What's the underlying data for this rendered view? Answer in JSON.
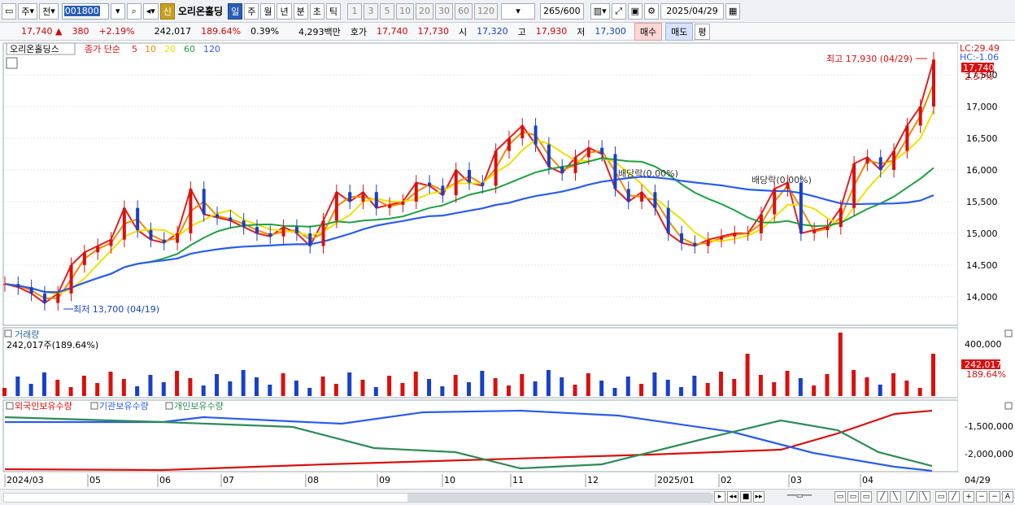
{
  "toolbar": {
    "period": "주",
    "mode": "전",
    "code": "001800",
    "new_badge": "신",
    "stock_name": "오리온홀딩",
    "timeframes": [
      "일",
      "주",
      "월",
      "년",
      "분",
      "초",
      "틱"
    ],
    "active_timeframe": "일",
    "intervals": [
      "1",
      "3",
      "5",
      "10",
      "20",
      "30",
      "60",
      "120"
    ],
    "count": "265",
    "count_total": "/600",
    "date": "2025/04/29"
  },
  "quote": {
    "price": "17,740",
    "up_arrow": "▲",
    "change": "380",
    "change_pct": "+2.19%",
    "volume": "242,017",
    "volume_ratio": "189.64%",
    "turnover": "0.39%",
    "trade_value": "4,293백만",
    "hoga_label": "호가",
    "ask": "17,740",
    "bid": "17,730",
    "open_label": "시",
    "open": "17,320",
    "high_label": "고",
    "high": "17,930",
    "low_label": "저",
    "low": "17,300",
    "buy_label": "매수",
    "sell_label": "매도",
    "avg_label": "평"
  },
  "legend": {
    "name": "오리온홀딩스",
    "series_prefix": "종가 단순",
    "ma": [
      "5",
      "10",
      "20",
      "60",
      "120"
    ],
    "ma_colors": [
      "#e02020",
      "#f08a00",
      "#f0e000",
      "#20a040",
      "#2a5cf0"
    ]
  },
  "price_panel": {
    "lc": "LC:29.49",
    "hc": "HC:-1.06",
    "last_price_tag": "17,740",
    "last_pct": "2.37%",
    "high_note": "최고 17,930 (04/29)",
    "low_note": "최저 13,700 (04/19)",
    "div_note_1": "배당락(0.00%)",
    "div_note_2": "배당락(0.00%)",
    "y_ticks": [
      "17,500",
      "17,000",
      "16,500",
      "16,000",
      "15,500",
      "15,000",
      "14,500",
      "14,000"
    ]
  },
  "volume_panel": {
    "title": "거래량",
    "value": "242,017주(189.64%)",
    "y_tick": "400,000",
    "tag_value": "242,017",
    "tag_pct": "189.64%"
  },
  "holding_panel": {
    "series": [
      "외국인보유수량",
      "기관보유수량",
      "개인보유수량"
    ],
    "colors": [
      "#d81010",
      "#2a5cf0",
      "#2e8b57"
    ],
    "y_ticks": [
      "-1,500,000",
      "-2,000,000"
    ]
  },
  "x_axis": {
    "labels": [
      "2024/03",
      "05",
      "06",
      "07",
      "08",
      "09",
      "10",
      "11",
      "12",
      "2025/01",
      "02",
      "03",
      "04"
    ],
    "right_label": "04/29"
  },
  "chart_data": {
    "type": "candlestick",
    "weekly_close_points": [
      14200,
      14150,
      14050,
      13900,
      14050,
      14500,
      14700,
      14800,
      14900,
      15400,
      15050,
      14900,
      14850,
      15000,
      15700,
      15300,
      15250,
      15200,
      15100,
      15000,
      14950,
      15100,
      15000,
      14800,
      15200,
      15650,
      15500,
      15650,
      15400,
      15450,
      15500,
      15800,
      15750,
      15600,
      16000,
      15800,
      15750,
      16300,
      16500,
      16700,
      16400,
      16050,
      15950,
      16200,
      16350,
      16250,
      15700,
      15500,
      15650,
      15400,
      15000,
      14850,
      14800,
      14900,
      14950,
      15000,
      15000,
      15300,
      15700,
      15800,
      15000,
      15050,
      15100,
      15400,
      16100,
      16200,
      16000,
      16300,
      16700,
      17000,
      17740
    ],
    "ylim": [
      13600,
      17950
    ],
    "annotations": {
      "high": "최고 17,930 (04/29)",
      "low": "최저 13,700 (04/19)"
    }
  }
}
